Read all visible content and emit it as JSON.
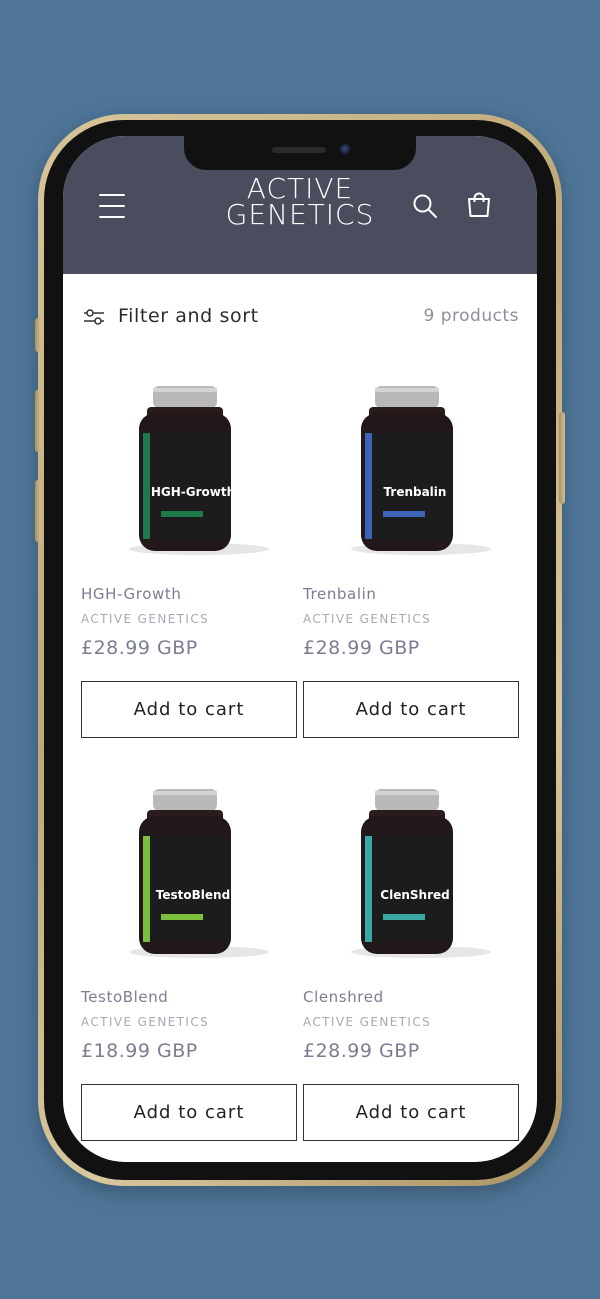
{
  "header": {
    "logo_line1": "ACTIVE",
    "logo_line2": "GENETICS",
    "bg_color": "#4a4d5e"
  },
  "icons": {
    "menu": "hamburger-menu-icon",
    "search": "search-icon",
    "cart": "cart-icon",
    "filter": "sliders-icon"
  },
  "filter_bar": {
    "label": "Filter and sort",
    "count": "9 products"
  },
  "products": [
    {
      "name": "HGH-Growth",
      "label_text": "HGH-Growth",
      "vendor": "ACTIVE GENETICS",
      "price": "£28.99 GBP",
      "button": "Add to cart",
      "accent": "#1f7a4a"
    },
    {
      "name": "Trenbalin",
      "label_text": "Trenbalin",
      "vendor": "ACTIVE GENETICS",
      "price": "£28.99 GBP",
      "button": "Add to cart",
      "accent": "#3d63b8"
    },
    {
      "name": "TestoBlend",
      "label_text": "TestoBlend",
      "vendor": "ACTIVE GENETICS",
      "price": "£18.99 GBP",
      "button": "Add to cart",
      "accent": "#7cbf3c"
    },
    {
      "name": "Clenshred",
      "label_text": "ClenShred",
      "vendor": "ACTIVE GENETICS",
      "price": "£28.99 GBP",
      "button": "Add to cart",
      "accent": "#3aa9a6"
    }
  ]
}
